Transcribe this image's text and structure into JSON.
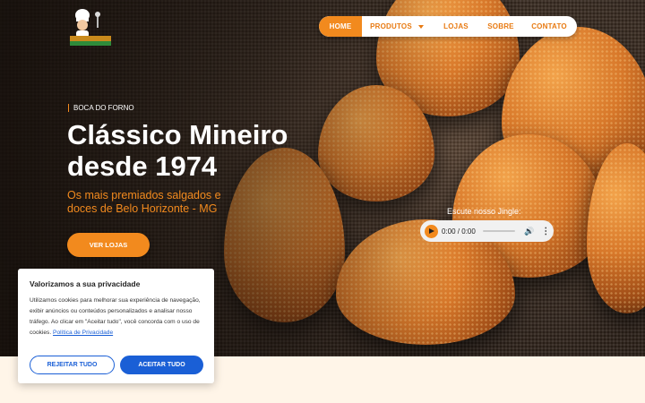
{
  "brand": {
    "logo_icon": "chef-logo-icon"
  },
  "nav": {
    "items": [
      {
        "label": "HOME",
        "active": true
      },
      {
        "label": "PRODUTOS",
        "has_dropdown": true
      },
      {
        "label": "LOJAS"
      },
      {
        "label": "SOBRE"
      },
      {
        "label": "CONTATO"
      }
    ]
  },
  "hero": {
    "eyebrow": "BOCA DO FORNO",
    "headline_line1": "Clássico Mineiro",
    "headline_line2": "desde 1974",
    "subtitle": "Os mais premiados salgados e doces de Belo Horizonte - MG",
    "cta_label": "VER LOJAS"
  },
  "audio": {
    "label": "Escute nosso Jingle:",
    "time": "0:00 / 0:00"
  },
  "cookie_banner": {
    "title": "Valorizamos a sua privacidade",
    "text": "Utilizamos cookies para melhorar sua experiência de navegação, exibir anúncios ou conteúdos personalizados e analisar nosso tráfego. Ao clicar em \"Aceitar tudo\", você concorda com o uso de cookies.",
    "link_label": "Política de Privacidade",
    "reject_label": "REJEITAR TUDO",
    "accept_label": "ACEITAR TUDO"
  },
  "colors": {
    "accent": "#f28a1e",
    "cookie_button": "#1a5fd6",
    "page_background": "#fff5e8"
  }
}
